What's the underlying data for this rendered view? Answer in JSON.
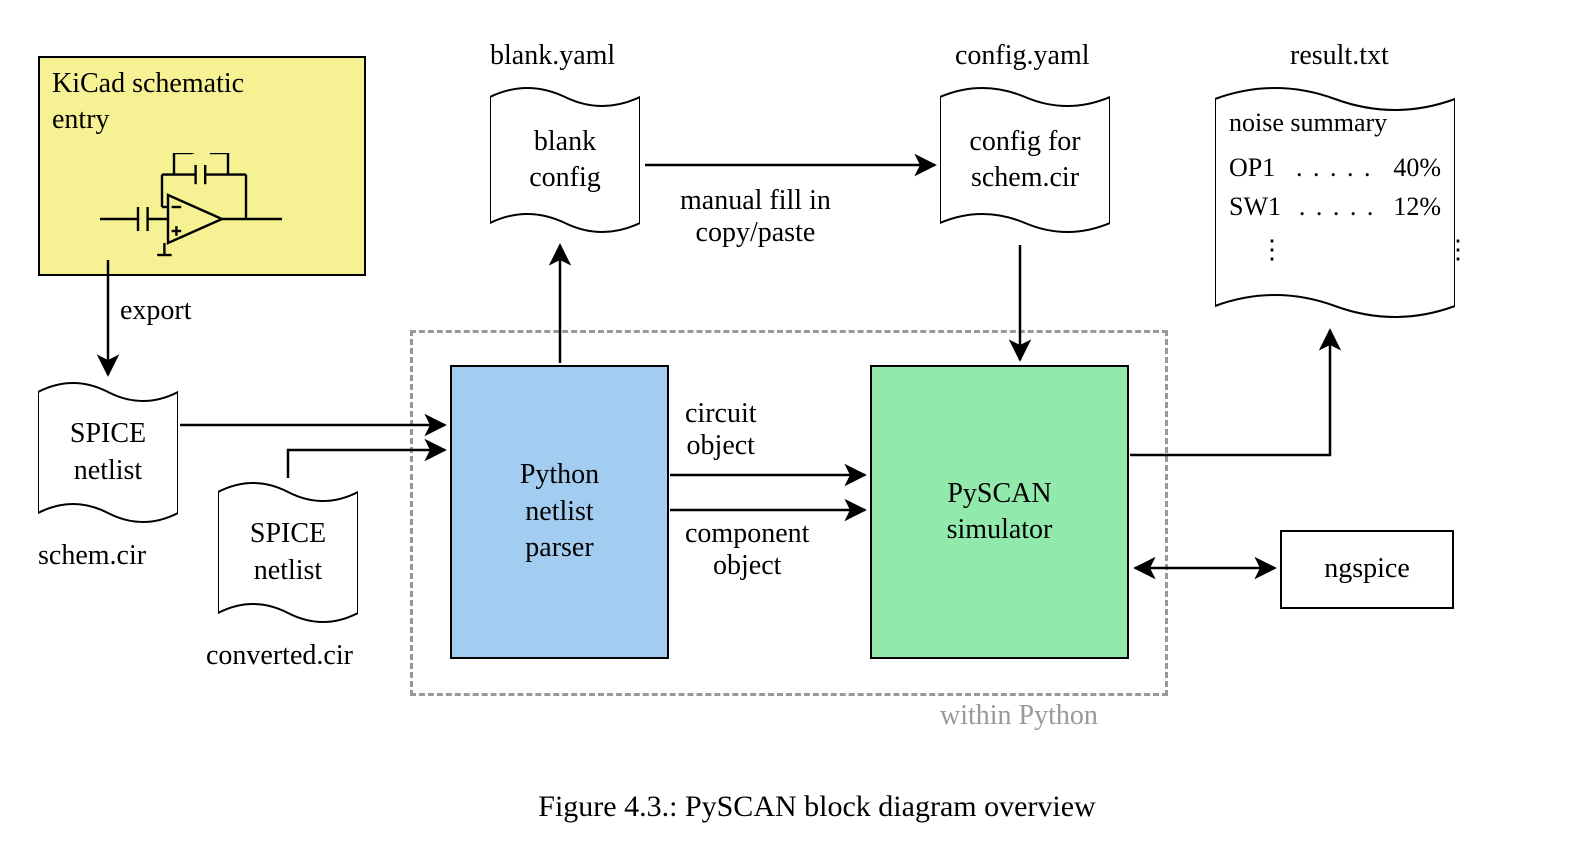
{
  "kicad": {
    "title": "KiCad schematic\nentry"
  },
  "docs": {
    "spice1": {
      "text": "SPICE\nnetlist",
      "caption": "schem.cir"
    },
    "spice2": {
      "text": "SPICE\nnetlist",
      "caption": "converted.cir"
    },
    "blank": {
      "text": "blank\nconfig",
      "caption": "blank.yaml"
    },
    "config": {
      "text": "config for\nschem.cir",
      "caption": "config.yaml"
    },
    "result": {
      "caption": "result.txt",
      "header": "noise summary",
      "rows": [
        {
          "name": "OP1",
          "value": "40%"
        },
        {
          "name": "SW1",
          "value": "12%"
        }
      ]
    }
  },
  "blocks": {
    "parser": "Python\nnetlist\nparser",
    "simulator": "PySCAN\nsimulator",
    "ngspice": "ngspice"
  },
  "labels": {
    "export": "export",
    "manual": "manual fill in\ncopy/paste",
    "circuit": "circuit\nobject",
    "component": "component\nobject",
    "within": "within Python"
  },
  "caption": "Figure 4.3.: PySCAN block diagram overview"
}
